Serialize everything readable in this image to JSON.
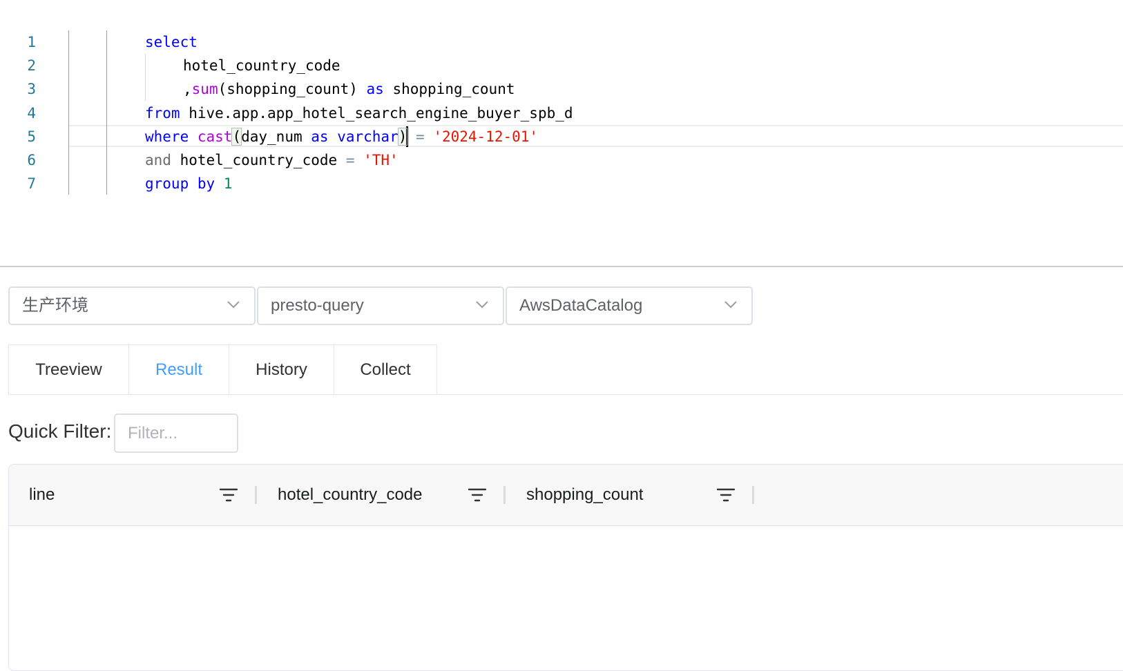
{
  "editor": {
    "line_numbers": [
      "1",
      "2",
      "3",
      "4",
      "5",
      "6",
      "7"
    ],
    "lines": {
      "l1": {
        "kw": "select"
      },
      "l2": {
        "text": "hotel_country_code"
      },
      "l3": {
        "comma": ",",
        "fn": "sum",
        "args": "(shopping_count) ",
        "kw": "as",
        "alias": " shopping_count"
      },
      "l4": {
        "kw": "from",
        "table": " hive.app.app_hotel_search_engine_buyer_spb_d"
      },
      "l5": {
        "kw1": "where",
        "sp": " ",
        "fn": "cast",
        "open": "(",
        "col": "day_num ",
        "kw2": "as",
        "kw3": " varchar",
        "close": ")",
        "eq": " = ",
        "str": "'2024-12-01'"
      },
      "l6": {
        "kw": "and",
        "col": " hotel_country_code ",
        "eq": "=",
        "str": " 'TH'"
      },
      "l7": {
        "kw": "group by",
        "num": " 1"
      }
    }
  },
  "selects": {
    "environment": "生产环境",
    "engine": "presto-query",
    "catalog": "AwsDataCatalog"
  },
  "tabs": [
    {
      "label": "Treeview"
    },
    {
      "label": "Result"
    },
    {
      "label": "History"
    },
    {
      "label": "Collect"
    }
  ],
  "active_tab": "Result",
  "quick_filter": {
    "label": "Quick Filter:",
    "placeholder": "Filter...",
    "value": ""
  },
  "grid": {
    "columns": [
      "line",
      "hotel_country_code",
      "shopping_count"
    ],
    "rows": []
  },
  "icons": {
    "dropdown": "chevron-down-icon",
    "filter": "filter-icon"
  },
  "colors": {
    "accent": "#409eff",
    "keyword": "#0000ff",
    "function": "#af00db",
    "string": "#e51400",
    "number": "#098658"
  }
}
